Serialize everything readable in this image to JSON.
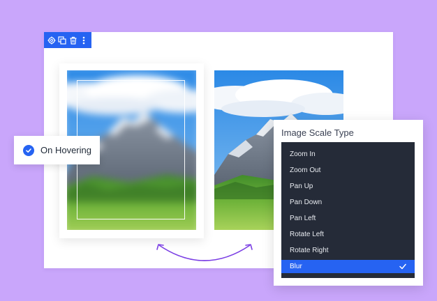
{
  "colors": {
    "background": "#c9a6fb",
    "accent": "#2663f2",
    "menu_bg": "#252b38",
    "arrow": "#7b3fe4"
  },
  "toolbar": {
    "icons": [
      "gear-icon",
      "duplicate-icon",
      "trash-icon",
      "more-vertical-icon"
    ]
  },
  "hover_chip": {
    "label": "On Hovering",
    "icon": "check-circle-icon"
  },
  "scale_panel": {
    "title": "Image Scale Type",
    "options": [
      {
        "label": "Zoom In",
        "selected": false
      },
      {
        "label": "Zoom Out",
        "selected": false
      },
      {
        "label": "Pan Up",
        "selected": false
      },
      {
        "label": "Pan Down",
        "selected": false
      },
      {
        "label": "Pan Left",
        "selected": false
      },
      {
        "label": "Rotate Left",
        "selected": false
      },
      {
        "label": "Rotate Right",
        "selected": false
      },
      {
        "label": "Blur",
        "selected": true
      }
    ],
    "selected_icon": "checkmark-icon"
  }
}
